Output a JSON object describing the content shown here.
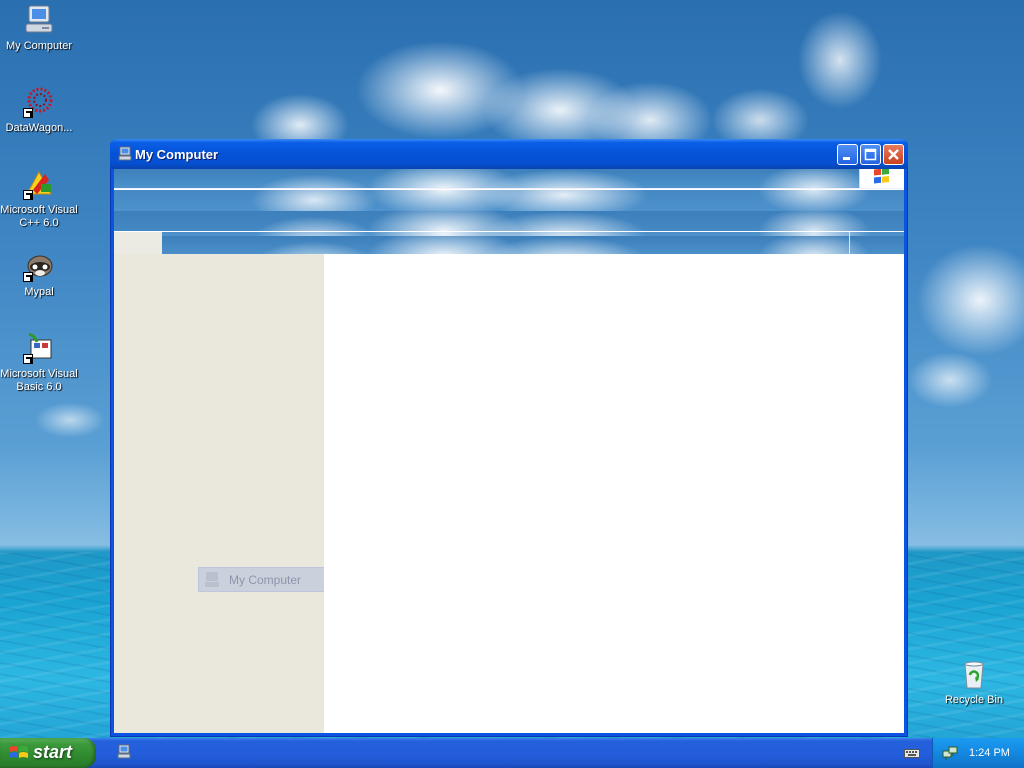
{
  "desktop": {
    "icons": [
      {
        "label": "My Computer"
      },
      {
        "label": "DataWagon..."
      },
      {
        "label": "Microsoft Visual C++ 6.0"
      },
      {
        "label": "Mypal"
      },
      {
        "label": "Microsoft Visual Basic 6.0"
      },
      {
        "label": "Recycle Bin"
      }
    ]
  },
  "window": {
    "title": "My Computer",
    "title_icon": "my-computer-icon",
    "buttons": [
      "minimize",
      "maximize",
      "close"
    ],
    "drag_ghost_label": "My Computer"
  },
  "taskbar": {
    "start_label": "start",
    "clock": "1:24 PM"
  },
  "colors": {
    "titlebar": "#0552d6",
    "start_button": "#3c9a3c",
    "taskbar": "#245edb",
    "task_pane": "#eae8dc"
  }
}
